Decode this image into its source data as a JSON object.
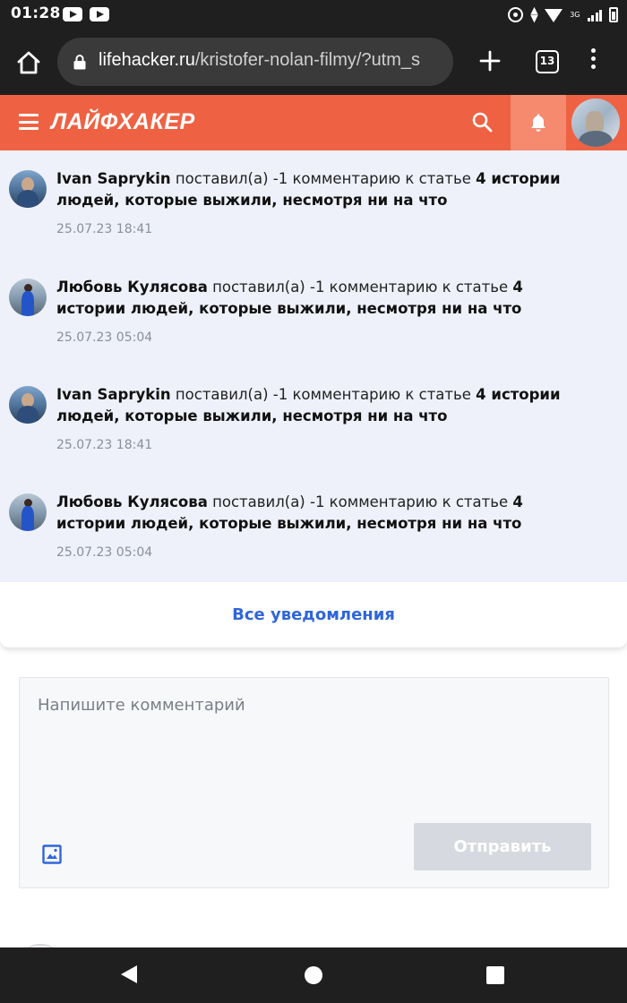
{
  "status_bar": {
    "time": "01:28",
    "network": "3G",
    "icons": [
      "youtube-icon",
      "youtube-icon",
      "sync-icon",
      "data-arrows-icon",
      "wifi-icon",
      "signal-icon",
      "battery-icon"
    ]
  },
  "browser": {
    "url_domain": "lifehacker.ru",
    "url_path": "/kristofer-nolan-filmy/?utm_s",
    "tab_count": "13",
    "icons": [
      "home-icon",
      "lock-icon",
      "plus-icon",
      "tabs-icon",
      "overflow-menu-icon"
    ]
  },
  "site_header": {
    "logo": "ЛАЙФХАКЕР",
    "accent_color": "#ee6243",
    "icons": [
      "hamburger-menu-icon",
      "search-icon",
      "bell-icon",
      "avatar"
    ]
  },
  "notifications": [
    {
      "user": "Ivan Saprykin",
      "action": " поставил(а) -1 комментарию к статье ",
      "article": "4 истории людей, которые выжили, несмотря ни на что",
      "date": "25.07.23 18:41"
    },
    {
      "user": "Любовь Кулясова",
      "action": " поставил(а) -1 комментарию к статье ",
      "article": "4 истории людей, которые выжили, несмотря ни на что",
      "date": "25.07.23 05:04"
    },
    {
      "user": "Ivan Saprykin",
      "action": " поставил(а) -1 комментарию к статье ",
      "article": "4 истории людей, которые выжили, несмотря ни на что",
      "date": "25.07.23 18:41"
    },
    {
      "user": "Любовь Кулясова",
      "action": " поставил(а) -1 комментарию к статье ",
      "article": "4 истории людей, которые выжили, несмотря ни на что",
      "date": "25.07.23 05:04"
    }
  ],
  "all_notifications_label": "Все уведомления",
  "comment": {
    "placeholder": "Напишите комментарий",
    "submit_label": "Отправить"
  },
  "link_color": "#2f66d9"
}
